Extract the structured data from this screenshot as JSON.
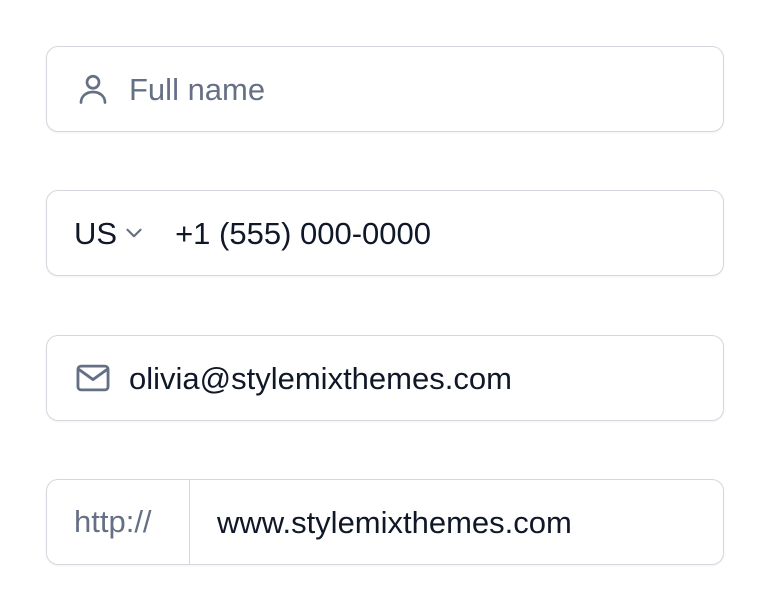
{
  "form": {
    "name_field": {
      "placeholder": "Full name",
      "icon": "user-icon"
    },
    "phone_field": {
      "country_code": "US",
      "country_chevron_icon": "chevron-down-icon",
      "value": "+1 (555) 000-0000"
    },
    "email_field": {
      "icon": "mail-icon",
      "value": "olivia@stylemixthemes.com"
    },
    "website_field": {
      "prefix": "http://",
      "value": "www.stylemixthemes.com"
    }
  },
  "colors": {
    "border": "#d5d7df",
    "placeholder_text": "#667085",
    "value_text": "#101828",
    "icon": "#667085"
  }
}
